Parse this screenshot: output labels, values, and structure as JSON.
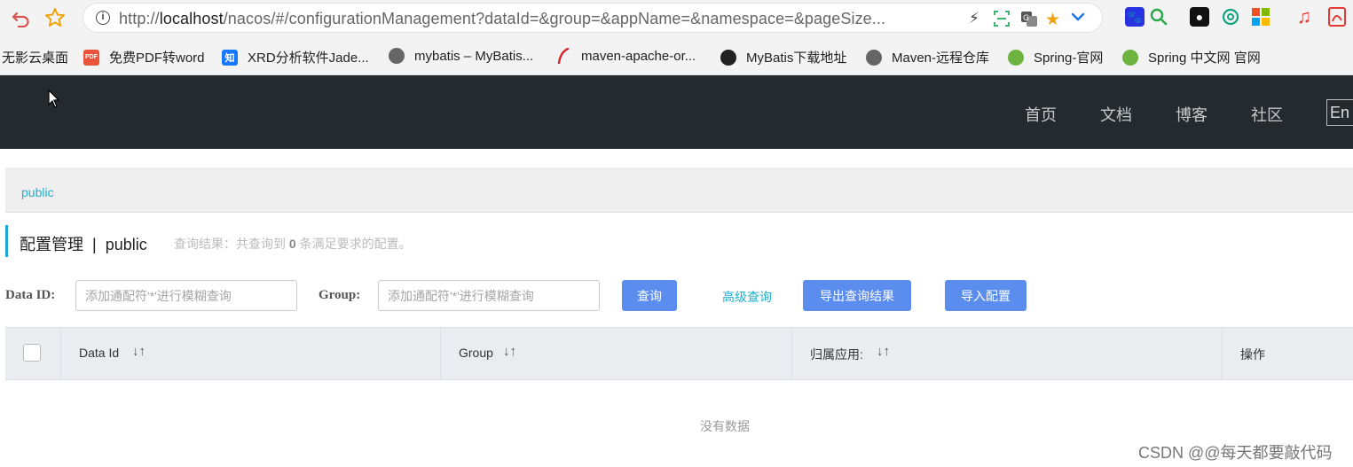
{
  "browser": {
    "url_prefix": "http://",
    "url_host": "localhost",
    "url_rest": "/nacos/#/configurationManagement?dataId=&group=&appName=&namespace=&pageSize...",
    "info_glyph": "i"
  },
  "bookmarks": [
    {
      "label": "无影云桌面",
      "icon": "none",
      "color": ""
    },
    {
      "label": "免费PDF转word",
      "icon": "pdf-icon",
      "glyph": "PDF",
      "color": "#e9543a"
    },
    {
      "label": "XRD分析软件Jade...",
      "icon": "zhi-icon",
      "glyph": "知",
      "color": "#1677ff"
    },
    {
      "label": "mybatis – MyBatis...",
      "icon": "globe-icon",
      "glyph": "",
      "color": "#666666"
    },
    {
      "label": "maven-apache-or...",
      "icon": "feather-icon",
      "glyph": "",
      "color": "#d8232a"
    },
    {
      "label": "MyBatis下载地址",
      "icon": "github-icon",
      "glyph": "",
      "color": "#222222"
    },
    {
      "label": "Maven-远程仓库",
      "icon": "globe-icon",
      "glyph": "",
      "color": "#666666"
    },
    {
      "label": "Spring-官网",
      "icon": "spring-icon",
      "glyph": "",
      "color": "#6db33f"
    },
    {
      "label": "Spring 中文网 官网",
      "icon": "spring-icon",
      "glyph": "",
      "color": "#6db33f"
    }
  ],
  "nav": {
    "items": [
      "首页",
      "文档",
      "博客",
      "社区"
    ],
    "lang": "En"
  },
  "breadcrumb": {
    "namespace": "public"
  },
  "page": {
    "title": "配置管理",
    "separator": "|",
    "namespace": "public",
    "result_prefix": "查询结果：共查询到",
    "result_count": "0",
    "result_suffix": "条满足要求的配置。"
  },
  "filters": {
    "dataid_label": "Data ID:",
    "dataid_placeholder": "添加通配符'*'进行模糊查询",
    "group_label": "Group:",
    "group_placeholder": "添加通配符'*'进行模糊查询",
    "query_button": "查询",
    "advanced_query": "高级查询",
    "export_button": "导出查询结果",
    "import_button": "导入配置"
  },
  "table": {
    "columns": [
      "Data Id",
      "Group",
      "归属应用:",
      "操作"
    ],
    "sort_glyph": "↓↑",
    "empty": "没有数据"
  },
  "watermark": "CSDN @@每天都要敲代码"
}
